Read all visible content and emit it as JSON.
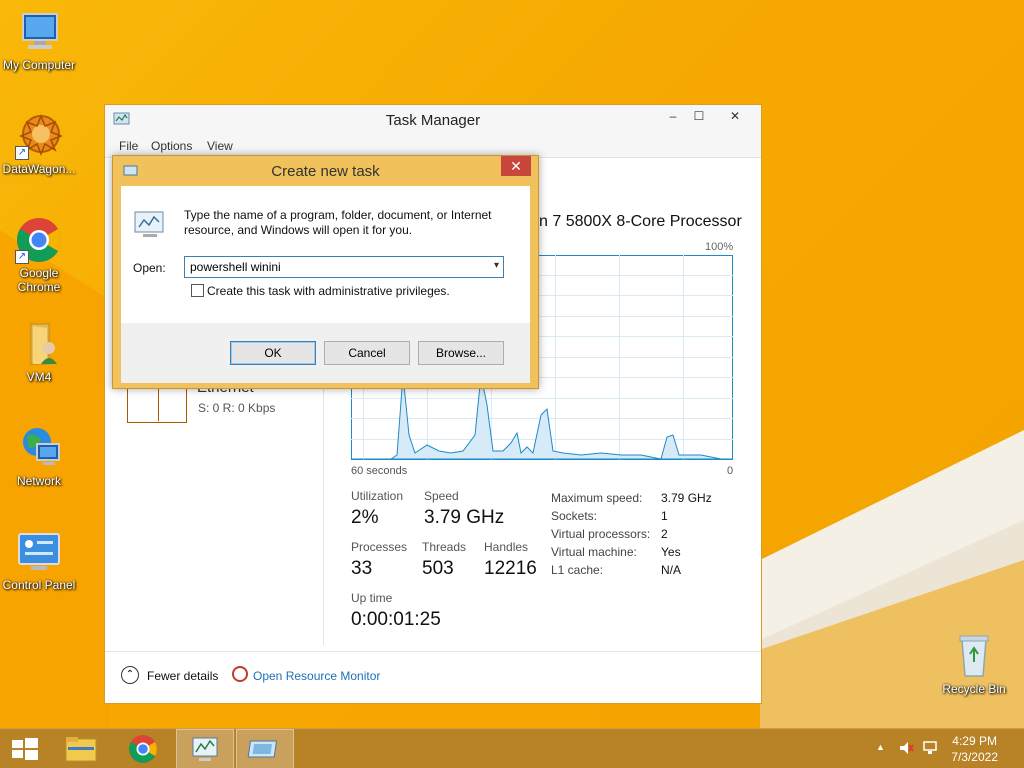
{
  "desktop": {
    "icons": [
      {
        "label": "My Computer"
      },
      {
        "label": "DataWagon..."
      },
      {
        "label": "Google Chrome"
      },
      {
        "label": "VM4"
      },
      {
        "label": "Network"
      },
      {
        "label": "Control Panel"
      },
      {
        "label": "Recycle Bin"
      }
    ]
  },
  "task_manager": {
    "title": "Task Manager",
    "menu": [
      "File",
      "Options",
      "View"
    ],
    "window_buttons": {
      "minimize": "–",
      "maximize": "☐",
      "close": "✕"
    },
    "processor_name_partial": "n 7 5800X 8-Core Processor",
    "graph": {
      "top_label": "100%",
      "left_label": "60 seconds",
      "right_label": "0"
    },
    "ethernet": {
      "label": "Ethernet",
      "stats": "S: 0 R: 0 Kbps"
    },
    "stats": {
      "utilization_label": "Utilization",
      "utilization_value": "2%",
      "speed_label": "Speed",
      "speed_value": "3.79 GHz",
      "processes_label": "Processes",
      "processes_value": "33",
      "threads_label": "Threads",
      "threads_value": "503",
      "handles_label": "Handles",
      "handles_value": "12216",
      "uptime_label": "Up time",
      "uptime_value": "0:00:01:25"
    },
    "details": [
      {
        "key": "Maximum speed:",
        "value": "3.79 GHz"
      },
      {
        "key": "Sockets:",
        "value": "1"
      },
      {
        "key": "Virtual processors:",
        "value": "2"
      },
      {
        "key": "Virtual machine:",
        "value": "Yes"
      },
      {
        "key": "L1 cache:",
        "value": "N/A"
      }
    ],
    "footer": {
      "fewer_details": "Fewer details",
      "open_resource_monitor": "Open Resource Monitor"
    }
  },
  "dialog": {
    "title": "Create new task",
    "close": "✕",
    "description": "Type the name of a program, folder, document, or Internet resource, and Windows will open it for you.",
    "open_label": "Open:",
    "open_value": "powershell winini",
    "admin_checkbox_label": "Create this task with administrative privileges.",
    "ok": "OK",
    "cancel": "Cancel",
    "browse": "Browse..."
  },
  "taskbar": {
    "time": "4:29 PM",
    "date": "7/3/2022"
  }
}
